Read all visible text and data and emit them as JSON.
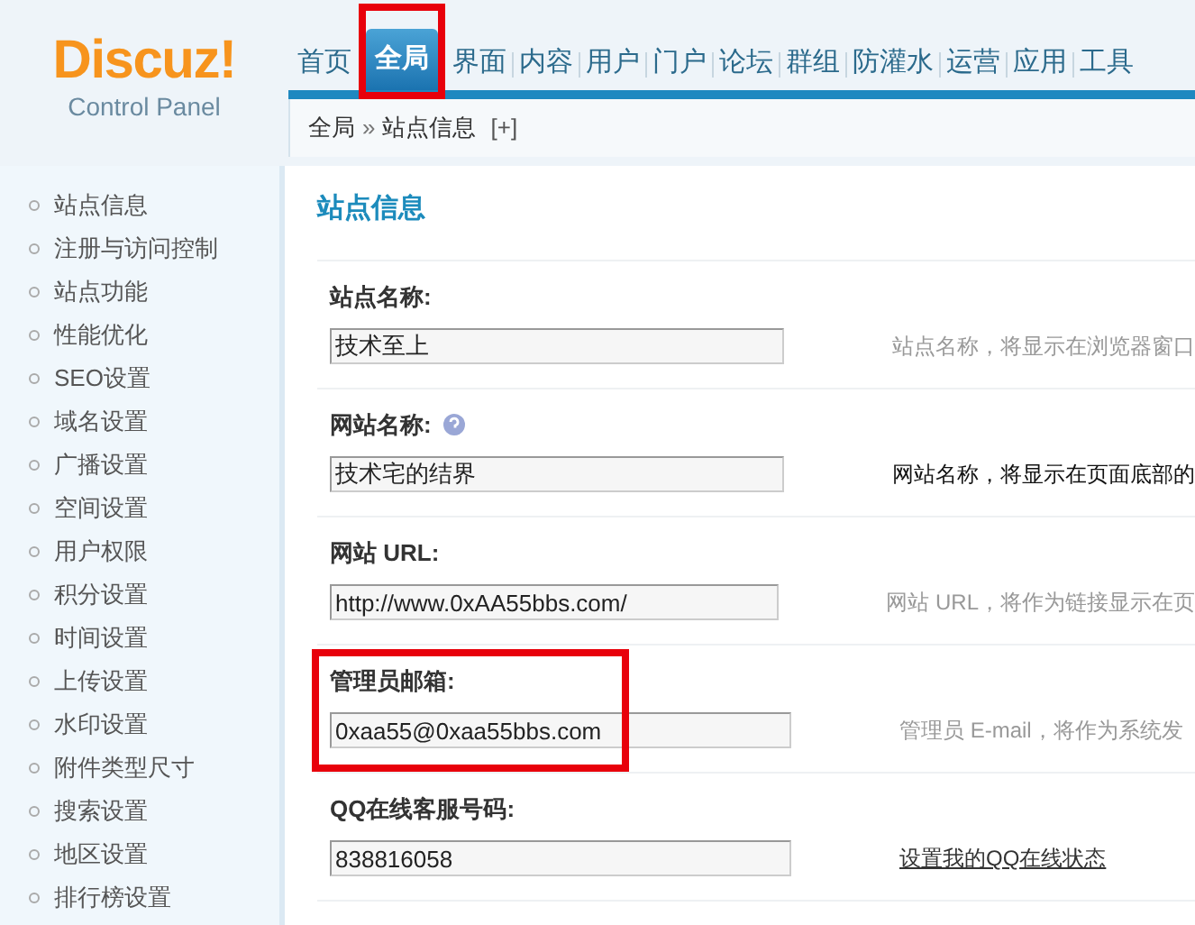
{
  "logo": {
    "name": "Discuz!",
    "subtitle": "Control Panel"
  },
  "nav_tabs": [
    {
      "label": "首页",
      "selected": false,
      "highlighted": false
    },
    {
      "label": "全局",
      "selected": true,
      "highlighted": true
    },
    {
      "label": "界面",
      "selected": false,
      "highlighted": false
    },
    {
      "label": "内容",
      "selected": false,
      "highlighted": false
    },
    {
      "label": "用户",
      "selected": false,
      "highlighted": false
    },
    {
      "label": "门户",
      "selected": false,
      "highlighted": false
    },
    {
      "label": "论坛",
      "selected": false,
      "highlighted": false
    },
    {
      "label": "群组",
      "selected": false,
      "highlighted": false
    },
    {
      "label": "防灌水",
      "selected": false,
      "highlighted": false
    },
    {
      "label": "运营",
      "selected": false,
      "highlighted": false
    },
    {
      "label": "应用",
      "selected": false,
      "highlighted": false
    },
    {
      "label": "工具",
      "selected": false,
      "highlighted": false
    }
  ],
  "breadcrumb": {
    "items": [
      "全局",
      "站点信息"
    ],
    "separator": "»",
    "add": "[+]"
  },
  "sidebar": {
    "items": [
      "站点信息",
      "注册与访问控制",
      "站点功能",
      "性能优化",
      "SEO设置",
      "域名设置",
      "广播设置",
      "空间设置",
      "用户权限",
      "积分设置",
      "时间设置",
      "上传设置",
      "水印设置",
      "附件类型尺寸",
      "搜索设置",
      "地区设置",
      "排行榜设置"
    ]
  },
  "page_title": "站点信息",
  "settings": [
    {
      "label": "站点名称:",
      "help_icon": false,
      "value": "技术至上",
      "note": "站点名称，将显示在浏览器窗口",
      "kind": "hint",
      "highlighted": false
    },
    {
      "label": "网站名称:",
      "help_icon": true,
      "value": "技术宅的结界",
      "note": "网站名称，将显示在页面底部的",
      "kind": "strong",
      "highlighted": false
    },
    {
      "label": "网站 URL:",
      "help_icon": false,
      "value": "http://www.0xAA55bbs.com/",
      "note": "网站 URL，将作为链接显示在页",
      "kind": "hint",
      "highlighted": false
    },
    {
      "label": "管理员邮箱:",
      "help_icon": false,
      "value": "0xaa55@0xaa55bbs.com",
      "note": "管理员 E-mail，将作为系统发",
      "kind": "hint",
      "highlighted": true
    },
    {
      "label": "QQ在线客服号码:",
      "help_icon": false,
      "value": "838816058",
      "note": "设置我的QQ在线状态",
      "kind": "link",
      "highlighted": false
    }
  ]
}
